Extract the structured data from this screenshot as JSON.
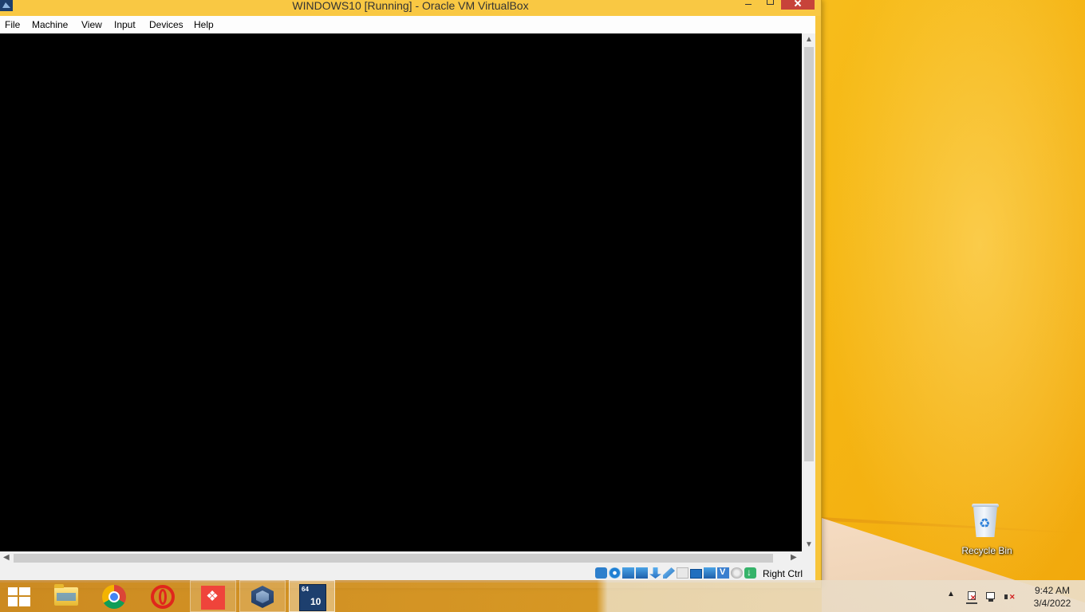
{
  "window": {
    "title": "WINDOWS10 [Running] - Oracle VM VirtualBox"
  },
  "menubar": {
    "items": [
      "File",
      "Machine",
      "View",
      "Input",
      "Devices",
      "Help"
    ]
  },
  "statusbar": {
    "host_key_label": "Right Ctrl",
    "icons": [
      "storage-icon",
      "optical-drive-icon",
      "audio-icon",
      "network-icon",
      "usb-icon",
      "shared-folders-icon",
      "display-icon",
      "video-capture-icon",
      "virtualization-icon",
      "mouse-integration-icon",
      "keyboard-icon"
    ]
  },
  "desktop": {
    "recycle_bin_label": "Recycle Bin"
  },
  "taskbar": {
    "apps": [
      "start-button",
      "file-explorer",
      "chrome",
      "opera",
      "anydesk",
      "virtualbox-manager",
      "windows10-vm"
    ],
    "vm_icon_badge_top": "64",
    "vm_icon_badge_main": "10"
  },
  "tray": {
    "time": "9:42 AM",
    "date": "3/4/2022"
  },
  "colors": {
    "desktop_accent": "#f7c21a",
    "close_button": "#c7433a",
    "vm_screen": "#000000"
  }
}
